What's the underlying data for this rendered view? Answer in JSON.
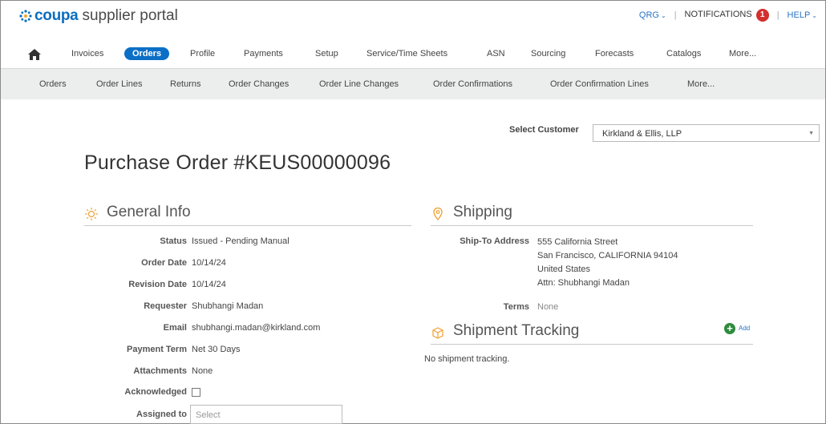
{
  "header": {
    "brand": "coupa",
    "portal": "supplier portal",
    "qrg": "QRG",
    "notifications": "NOTIFICATIONS",
    "notification_count": "1",
    "help": "HELP",
    "accent_color": "#0b6fc6"
  },
  "main_tabs": [
    {
      "label": "Invoices",
      "active": false
    },
    {
      "label": "Orders",
      "active": true
    },
    {
      "label": "Profile",
      "active": false
    },
    {
      "label": "Payments",
      "active": false
    },
    {
      "label": "Setup",
      "active": false
    },
    {
      "label": "Service/Time Sheets",
      "active": false
    },
    {
      "label": "ASN",
      "active": false
    },
    {
      "label": "Sourcing",
      "active": false
    },
    {
      "label": "Forecasts",
      "active": false
    },
    {
      "label": "Catalogs",
      "active": false
    },
    {
      "label": "More...",
      "active": false
    }
  ],
  "sub_tabs": [
    "Orders",
    "Order Lines",
    "Returns",
    "Order Changes",
    "Order Line Changes",
    "Order Confirmations",
    "Order Confirmation Lines",
    "More..."
  ],
  "customer": {
    "label": "Select Customer",
    "value": "Kirkland & Ellis, LLP"
  },
  "page_title": "Purchase Order #KEUS00000096",
  "general_info": {
    "title": "General Info",
    "status_label": "Status",
    "status": "Issued - Pending Manual",
    "order_date_label": "Order Date",
    "order_date": "10/14/24",
    "revision_date_label": "Revision Date",
    "revision_date": "10/14/24",
    "requester_label": "Requester",
    "requester": "Shubhangi Madan",
    "email_label": "Email",
    "email": "shubhangi.madan@kirkland.com",
    "payment_term_label": "Payment Term",
    "payment_term": "Net 30 Days",
    "attachments_label": "Attachments",
    "attachments": "None",
    "acknowledged_label": "Acknowledged",
    "assigned_label": "Assigned to",
    "assigned_placeholder": "Select"
  },
  "shipping": {
    "title": "Shipping",
    "ship_to_label": "Ship-To Address",
    "address_line1": "555 California Street",
    "address_line2": "San Francisco, CALIFORNIA 94104",
    "address_line3": "United States",
    "address_line4": "Attn: Shubhangi Madan",
    "terms_label": "Terms",
    "terms": "None"
  },
  "tracking": {
    "title": "Shipment Tracking",
    "add_label": "Add",
    "empty_text": "No shipment tracking."
  }
}
